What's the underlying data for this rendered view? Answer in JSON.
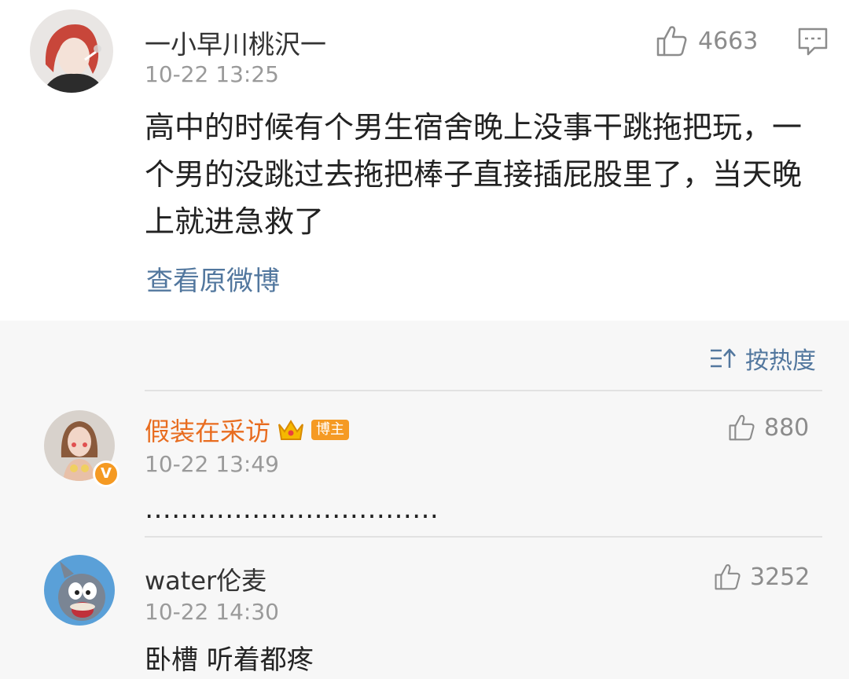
{
  "post": {
    "username": "一小早川桃沢一",
    "time": "10-22 13:25",
    "likes": "4663",
    "text": "高中的时候有个男生宿舍晚上没事干跳拖把玩，一个男的没跳过去拖把棒子直接插屁股里了，当天晚上就进急救了",
    "view_original": "查看原微博",
    "icons": {
      "like": "thumbs-up-icon",
      "comment": "comment-icon"
    }
  },
  "sort": {
    "label": "按热度",
    "icon": "sort-icon"
  },
  "comments": [
    {
      "username": "假装在采访",
      "badge": "博主",
      "time": "10-22 13:49",
      "likes": "880",
      "text": "……………………………",
      "verified_mark": "V"
    },
    {
      "username": "water伦麦",
      "time": "10-22 14:30",
      "likes": "3252",
      "text": "卧槽 听着都疼"
    }
  ],
  "colors": {
    "link": "#52779e",
    "muted": "#9a9a9a",
    "badge": "#f59a23",
    "comments_bg": "#f7f7f7"
  }
}
